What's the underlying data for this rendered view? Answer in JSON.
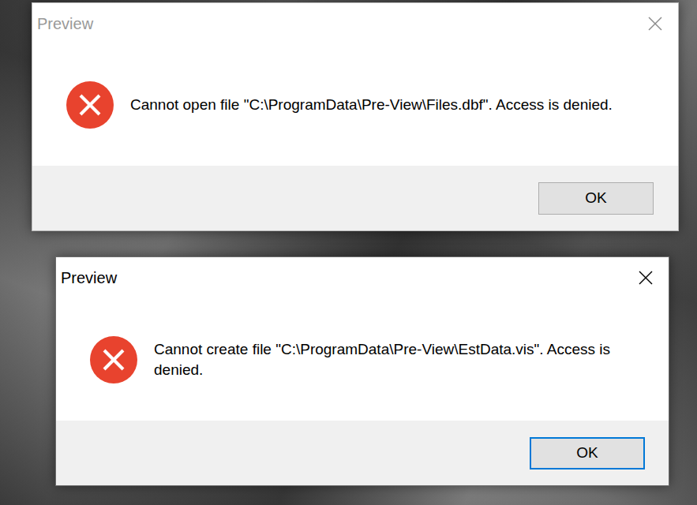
{
  "windows": [
    {
      "title": "Preview",
      "active": false,
      "message": "Cannot open file \"C:\\ProgramData\\Pre-View\\Files.dbf\". Access is denied.",
      "buttons": [
        {
          "label": "OK",
          "focused": false
        }
      ]
    },
    {
      "title": "Preview",
      "active": true,
      "message": "Cannot create file \"C:\\ProgramData\\Pre-View\\EstData.vis\". Access is denied.",
      "buttons": [
        {
          "label": "OK",
          "focused": true
        }
      ]
    }
  ]
}
